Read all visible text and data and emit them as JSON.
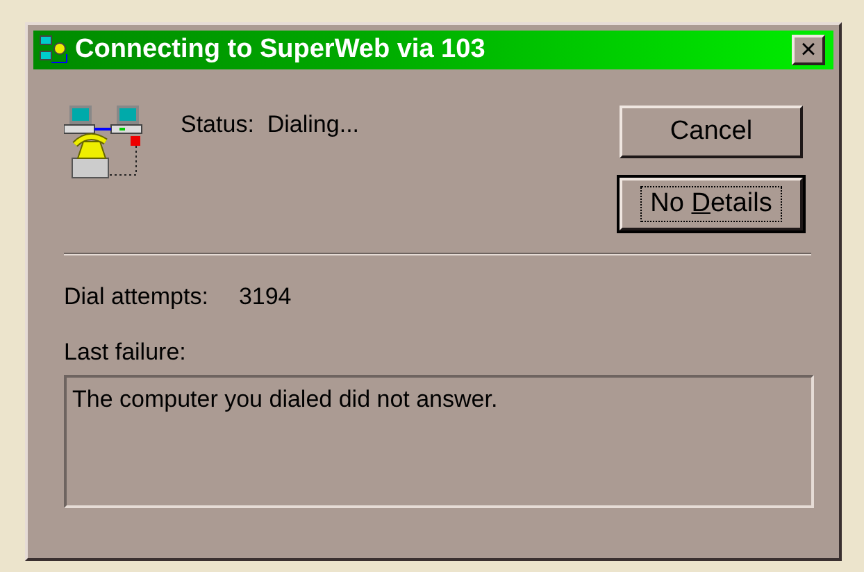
{
  "window": {
    "title": "Connecting to SuperWeb via 103",
    "close": "×"
  },
  "status": {
    "label": "Status:",
    "value": "Dialing..."
  },
  "buttons": [
    {
      "before": "Cancel",
      "focused": false
    },
    {
      "before": "No ",
      "mnemonic": "D",
      "after": "etails",
      "focused": true
    }
  ],
  "dial_attempts": {
    "label": "Dial attempts:",
    "value": "3194"
  },
  "last_failure": {
    "label": "Last failure:",
    "value": "The computer you dialed did not answer."
  }
}
